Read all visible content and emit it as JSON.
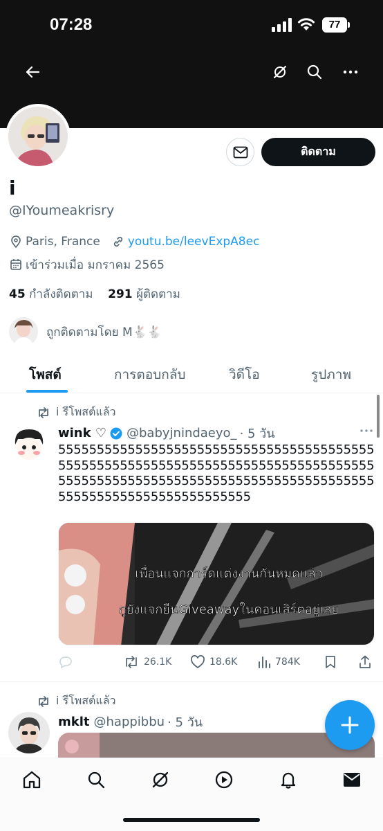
{
  "status_bar": {
    "time": "07:28",
    "battery": "77"
  },
  "profile": {
    "display_name": "i",
    "handle": "@IYoumeakrisry",
    "location": "Paris, France",
    "link": "youtu.be/leevExpA8ec",
    "joined": "เข้าร่วมเมื่อ มกราคม 2565",
    "following_count": "45",
    "following_label": "กำลังติดตาม",
    "followers_count": "291",
    "followers_label": "ผู้ติดตาม",
    "followed_by": "ถูกติดตามโดย M🐇🐇",
    "follow_button": "ติดตาม"
  },
  "tabs": [
    "โพสต์",
    "การตอบกลับ",
    "วิดีโอ",
    "รูปภาพ"
  ],
  "tweets": [
    {
      "retweet_label": "i รีโพสต์แล้ว",
      "name": "wink ♡",
      "handle": "@babyjnindaeyo_",
      "time": "· 5 วัน",
      "text": "5555555555555555555555555555555555555555555555555555555555555555555555555555555555555555555555555555555555555555555555555555555555555555555555555555",
      "media_caption_1": "เพื่อนแจกการ์ดแต่งงานกันหมดแล้ว",
      "media_caption_2": "กูยังแจกยืนGiveawayในคอนเสิร์ตอยู่เลย",
      "retweets": "26.1K",
      "likes": "18.6K",
      "views": "784K"
    },
    {
      "retweet_label": "i รีโพสต์แล้ว",
      "name": "mklt",
      "handle": "@happibbu",
      "time": "· 5 วัน"
    }
  ],
  "colors": {
    "accent": "#1d9bf0",
    "text": "#0f1419",
    "muted": "#536471"
  }
}
